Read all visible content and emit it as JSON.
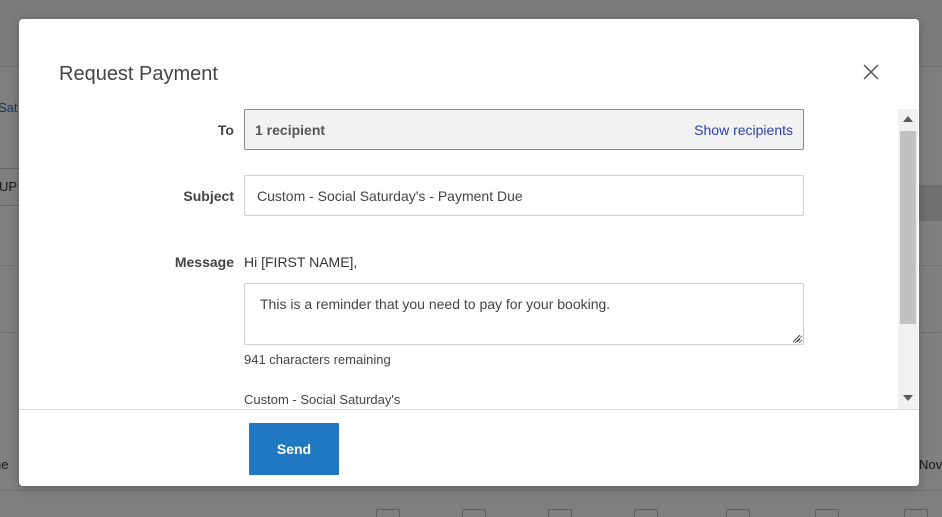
{
  "background": {
    "link_fragment": "Sat",
    "input_fragment": "UP",
    "col_left": "ne",
    "col_right": "Nov"
  },
  "modal": {
    "title": "Request Payment",
    "close_icon": "close-icon",
    "to": {
      "label": "To",
      "recipient_count": "1 recipient",
      "show_link": "Show recipients"
    },
    "subject": {
      "label": "Subject",
      "value": "Custom - Social Saturday's - Payment Due"
    },
    "message": {
      "label": "Message",
      "greeting": "Hi [FIRST NAME],",
      "body": "This is a reminder that you need to pay for your booking.",
      "chars_remaining": "941 characters remaining",
      "signature": "Custom - Social Saturday's"
    },
    "send_label": "Send"
  },
  "colors": {
    "primary_button": "#1f78c1",
    "link": "#2b3fb0",
    "overlay": "rgba(0,0,0,0.5)"
  }
}
